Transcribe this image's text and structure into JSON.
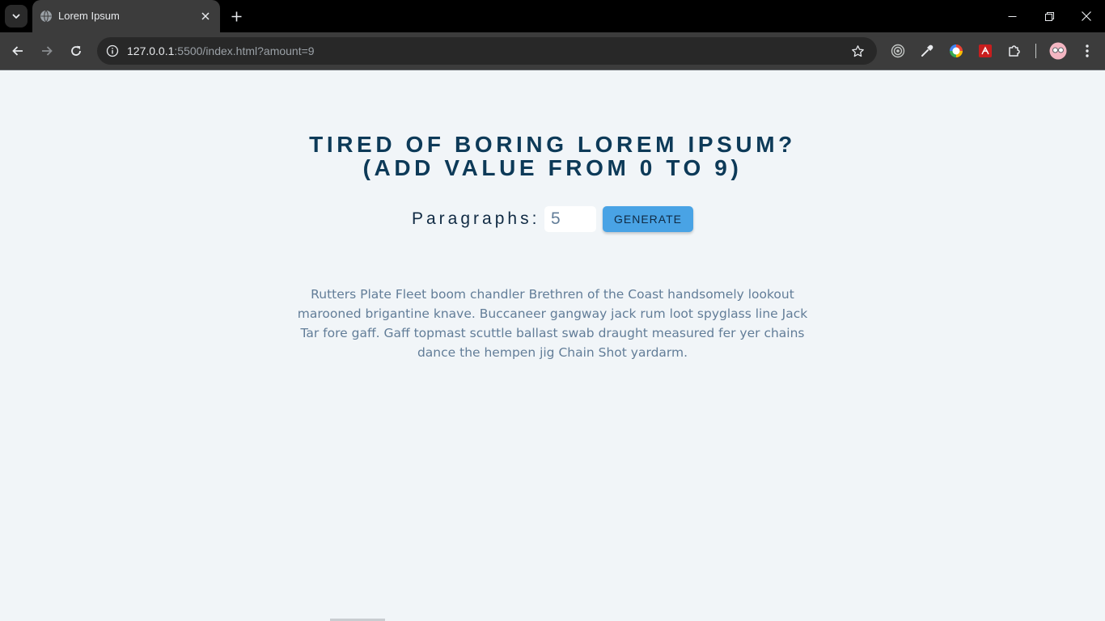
{
  "browser": {
    "tab_title": "Lorem Ipsum",
    "url_host": "127.0.0.1",
    "url_rest": ":5500/index.html?amount=9"
  },
  "page": {
    "headline_line1": "Tired of boring lorem ipsum?",
    "headline_line2": "(Add value from 0 to 9)",
    "paragraphs_label": "Paragraphs:",
    "amount_value": "5",
    "generate_label": "Generate",
    "lorem_text": "Rutters Plate Fleet boom chandler Brethren of the Coast handsomely lookout marooned brigantine knave. Buccaneer gangway jack rum loot spyglass line Jack Tar fore gaff. Gaff topmast scuttle ballast swab draught measured fer yer chains dance the hempen jig Chain Shot yardarm."
  },
  "icons": {
    "tab_menu": "chevron-down-icon",
    "favicon": "globe-icon",
    "tab_close": "close-icon",
    "new_tab": "plus-icon",
    "minimize": "minimize-icon",
    "restore": "restore-icon",
    "close_window": "close-icon",
    "back": "arrow-left-icon",
    "forward": "arrow-right-icon",
    "reload": "reload-icon",
    "site_info": "info-icon",
    "bookmark": "star-icon",
    "extensions": [
      "target-icon",
      "eyedropper-icon",
      "color-circle-icon",
      "pdf-icon",
      "puzzle-icon"
    ],
    "profile": "avatar-icon",
    "menu": "kebab-menu-icon"
  },
  "colors": {
    "headline": "#0d3a58",
    "page_background": "#f1f5f8",
    "button": "#49a3e5",
    "body_text": "#627d98"
  }
}
